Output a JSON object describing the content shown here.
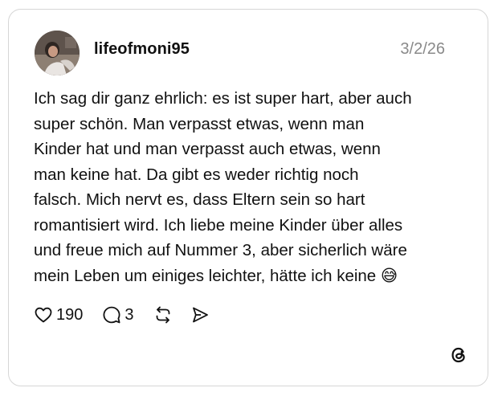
{
  "post": {
    "username": "lifeofmoni95",
    "date": "3/2/26",
    "text": "Ich sag dir ganz ehrlich: es ist super hart, aber auch\nsuper schön. Man verpasst etwas, wenn man\nKinder hat und man verpasst auch etwas, wenn\nman keine hat. Da gibt es weder richtig noch\nfalsch. Mich nervt es, dass Eltern sein so hart\nromantisiert wird. Ich liebe meine Kinder über alles\nund freue mich auf Nummer 3, aber sicherlich wäre\nmein Leben um einiges leichter, hätte ich keine 😅",
    "likes": "190",
    "replies": "3"
  },
  "icons": {
    "like": "heart-icon",
    "reply": "comment-icon",
    "repost": "repost-icon",
    "share": "send-icon",
    "brand": "threads-logo-icon"
  }
}
